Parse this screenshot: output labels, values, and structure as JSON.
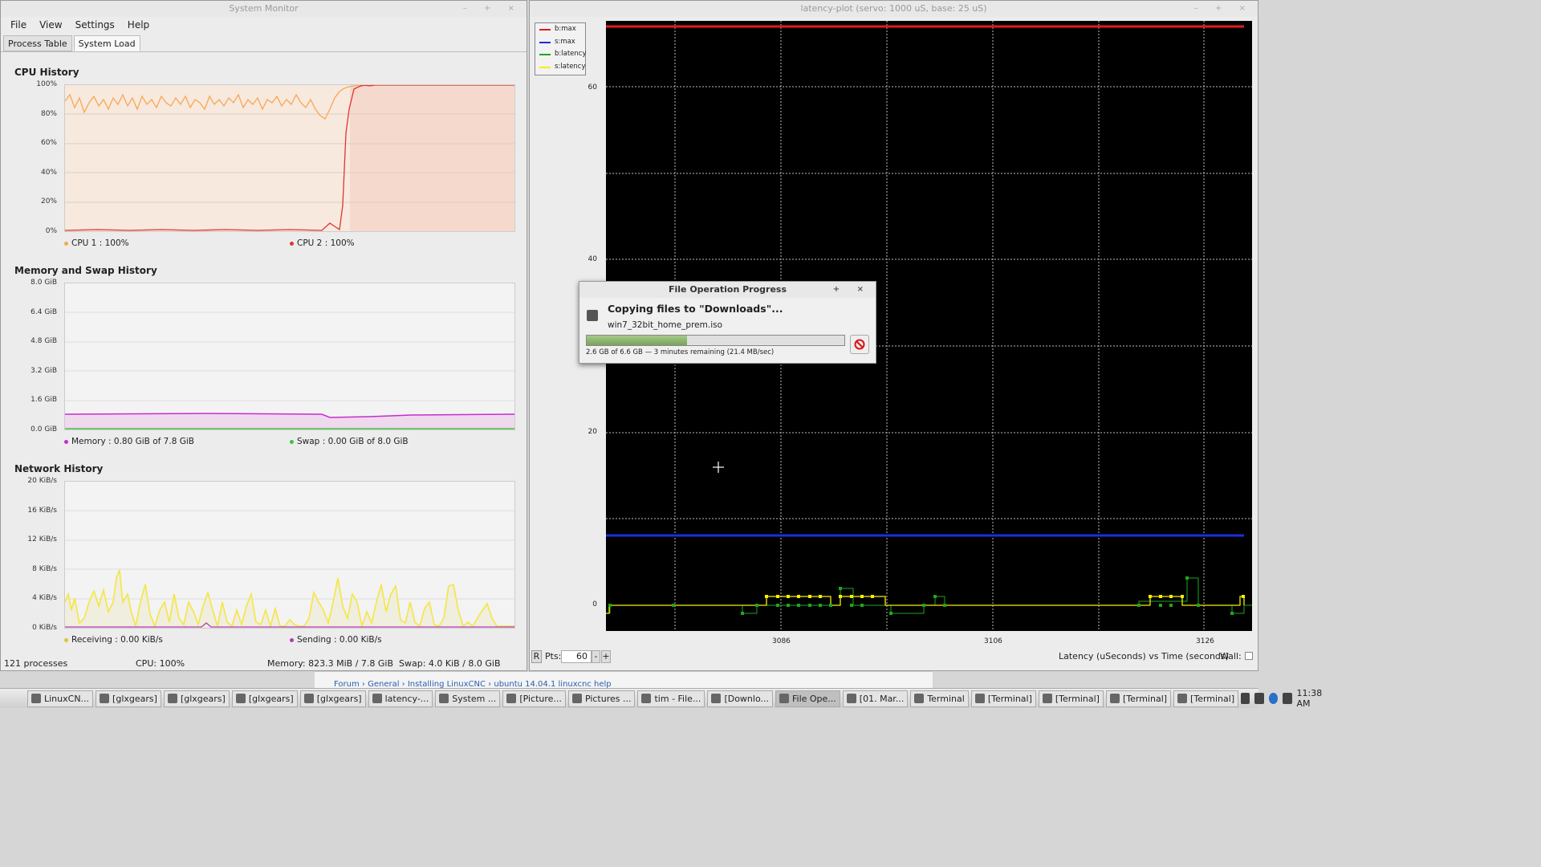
{
  "sysmon": {
    "title": "System Monitor",
    "menu": [
      "File",
      "View",
      "Settings",
      "Help"
    ],
    "tabs": [
      "Process Table",
      "System Load"
    ],
    "cpu": {
      "title": "CPU History",
      "yticks": [
        "100%",
        "80%",
        "60%",
        "40%",
        "20%",
        "0%"
      ],
      "legend1": "CPU 1 : 100%",
      "legend2": "CPU 2 : 100%",
      "colors": {
        "cpu1": "#f7a757",
        "cpu2": "#e3342f"
      }
    },
    "mem": {
      "title": "Memory and Swap History",
      "yticks": [
        "8.0 GiB",
        "6.4 GiB",
        "4.8 GiB",
        "3.2 GiB",
        "1.6 GiB",
        "0.0 GiB"
      ],
      "legend1": "Memory : 0.80 GiB of 7.8 GiB",
      "legend2": "Swap : 0.00 GiB of 8.0 GiB",
      "colors": {
        "memory": "#c52ec8",
        "swap": "#3ec43e"
      }
    },
    "net": {
      "title": "Network History",
      "yticks": [
        "20 KiB/s",
        "16 KiB/s",
        "12 KiB/s",
        "8 KiB/s",
        "4 KiB/s",
        "0 KiB/s"
      ],
      "legend1": "Receiving : 0.00 KiB/s",
      "legend2": "Sending : 0.00 KiB/s",
      "colors": {
        "receiving": "#f5e642",
        "sending": "#b33ab8"
      }
    },
    "status": {
      "processes": "121 processes",
      "cpu": "CPU: 100%",
      "memory": "Memory: 823.3 MiB / 7.8 GiB",
      "swap": "Swap: 4.0 KiB / 8.0 GiB"
    }
  },
  "latency": {
    "title": "latency-plot (servo: 1000 uS, base: 25 uS)",
    "legend": [
      "b:max",
      "s:max",
      "b:latency",
      "s:latency"
    ],
    "yticks": [
      "60",
      "40",
      "20",
      "0"
    ],
    "xticks": [
      "3086",
      "3106",
      "3126"
    ],
    "r_button": "R",
    "pts_label": "Pts:",
    "pts_value": "60",
    "minus": "-",
    "plus": "+",
    "axis_caption": "Latency (uSeconds) vs Time (seconds)",
    "wall_label": "Wall:",
    "colors": {
      "b_max": "#e21b1b",
      "s_max": "#1a2fe0",
      "b_latency": "#1fa51f",
      "s_latency": "#f3f000"
    }
  },
  "dialog": {
    "title": "File Operation Progress",
    "heading": "Copying files to \"Downloads\"...",
    "file": "win7_32bit_home_prem.iso",
    "progress": 0.39,
    "detail": "2.6 GB of 6.6 GB — 3 minutes remaining (21.4 MB/sec)"
  },
  "browser": {
    "breadcrumbs": [
      "Forum",
      "General",
      "Installing LinuxCNC",
      "ubuntu 14.04.1 linuxcnc help"
    ]
  },
  "taskbar": {
    "buttons": [
      "LinuxCN...",
      "[glxgears]",
      "[glxgears]",
      "[glxgears]",
      "[glxgears]",
      "latency-...",
      "System ...",
      "[Picture...",
      "Pictures ...",
      "tim - File...",
      "[Downlo...",
      "File Ope...",
      "[01. Mar...",
      "Terminal",
      "[Terminal]",
      "[Terminal]",
      "[Terminal]",
      "[Terminal]"
    ],
    "active_index": 11,
    "clock": "11:38 AM"
  }
}
